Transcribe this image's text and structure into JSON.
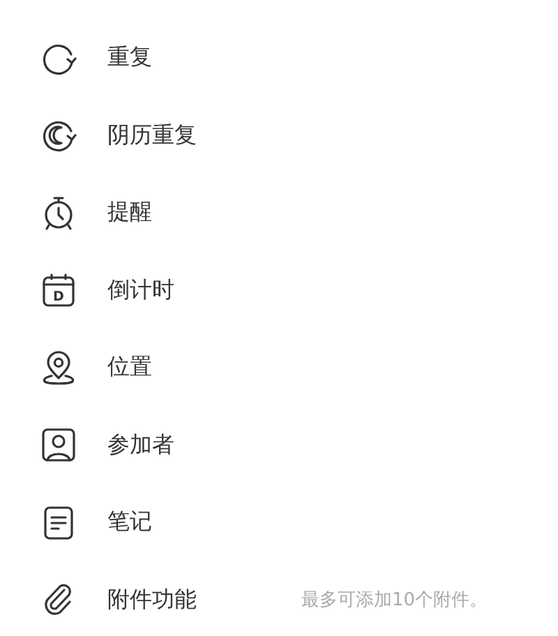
{
  "items": [
    {
      "kind": "repeat",
      "label": "重复"
    },
    {
      "kind": "lunar-repeat",
      "label": "阴历重复"
    },
    {
      "kind": "reminder",
      "label": "提醒"
    },
    {
      "kind": "countdown",
      "label": "倒计时",
      "icon_text": "D"
    },
    {
      "kind": "location",
      "label": "位置"
    },
    {
      "kind": "attendees",
      "label": "参加者"
    },
    {
      "kind": "notes",
      "label": "笔记"
    },
    {
      "kind": "attachment",
      "label": "附件功能",
      "hint": "最多可添加10个附件。"
    }
  ]
}
